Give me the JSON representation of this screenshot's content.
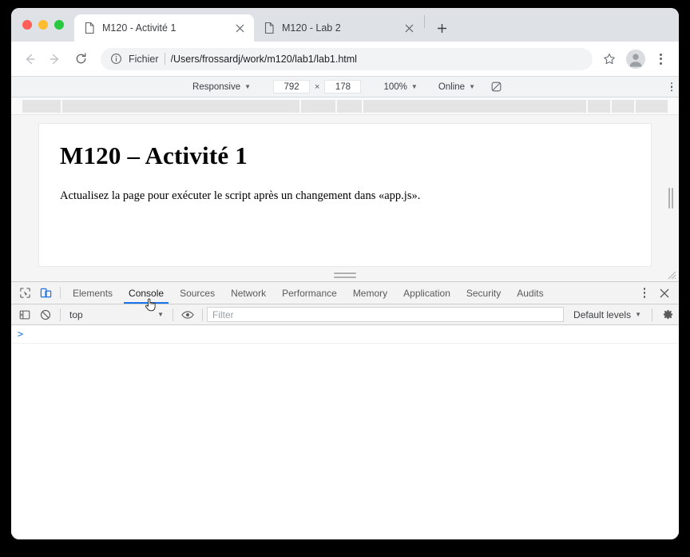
{
  "browser": {
    "traffic_lights": [
      "close",
      "minimize",
      "maximize"
    ],
    "tabs": [
      {
        "title": "M120 - Activité 1",
        "active": true,
        "favicon": "document-icon",
        "close": "×"
      },
      {
        "title": "M120 - Lab 2",
        "active": false,
        "favicon": "document-icon",
        "close": "×"
      }
    ],
    "new_tab_label": "+",
    "nav": {
      "back": "back-arrow",
      "forward": "forward-arrow",
      "reload": "reload-arrow"
    },
    "omnibox": {
      "info_icon": "info-circle-icon",
      "scheme_label": "Fichier",
      "url": "/Users/frossardj/work/m120/lab1/lab1.html"
    },
    "bookmark_icon": "star-icon",
    "profile_icon": "avatar-icon",
    "menu_icon": "kebab-menu-icon"
  },
  "device_toolbar": {
    "device": "Responsive",
    "width": "792",
    "height": "178",
    "dim_separator": "×",
    "zoom": "100%",
    "throttling": "Online",
    "rotate_icon": "rotate-device-icon",
    "menu_icon": "kebab-menu-icon",
    "media_segments": [
      {
        "width_pct": 6.2
      },
      {
        "width_pct": 37.0
      },
      {
        "width_pct": 5.6
      },
      {
        "width_pct": 4.0
      },
      {
        "width_pct": 34.8
      },
      {
        "width_pct": 3.8
      },
      {
        "width_pct": 3.6
      },
      {
        "width_pct": 5.0
      }
    ]
  },
  "page": {
    "heading": "M120 – Activité 1",
    "paragraph": "Actualisez la page pour exécuter le script après un changement dans «app.js»."
  },
  "devtools": {
    "inspect_icon": "inspect-element-icon",
    "device_toggle_icon": "device-toolbar-icon",
    "tabs": [
      {
        "label": "Elements",
        "active": false
      },
      {
        "label": "Console",
        "active": true
      },
      {
        "label": "Sources",
        "active": false
      },
      {
        "label": "Network",
        "active": false
      },
      {
        "label": "Performance",
        "active": false
      },
      {
        "label": "Memory",
        "active": false
      },
      {
        "label": "Application",
        "active": false
      },
      {
        "label": "Security",
        "active": false
      },
      {
        "label": "Audits",
        "active": false
      }
    ],
    "more_icon": "kebab-menu-icon",
    "close_icon": "close-icon",
    "console_toolbar": {
      "sidebar_icon": "console-sidebar-icon",
      "clear_icon": "clear-console-icon",
      "context": "top",
      "eye_icon": "live-expression-icon",
      "filter_placeholder": "Filter",
      "levels": "Default levels",
      "settings_icon": "gear-icon"
    },
    "console_prompt": ">"
  },
  "colors": {
    "accent": "#1a73e8",
    "tabstrip": "#dee1e6",
    "toolbar_bg": "#ffffff",
    "devtools_bg": "#f3f3f3",
    "traffic_red": "#ff5f57",
    "traffic_yellow": "#febc2e",
    "traffic_green": "#28c840"
  }
}
